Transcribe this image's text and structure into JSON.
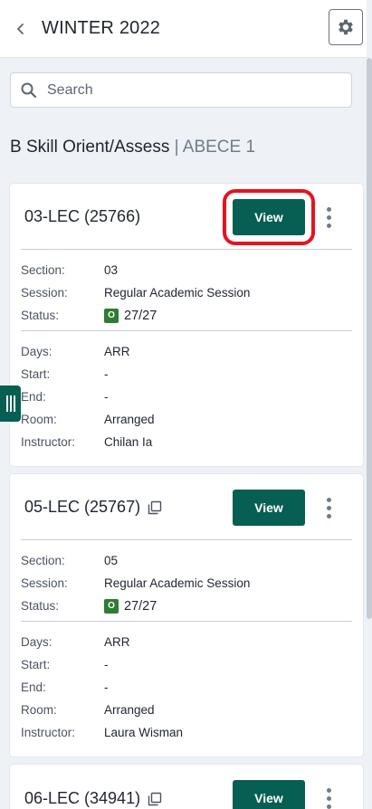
{
  "header": {
    "title": "WINTER 2022"
  },
  "search": {
    "placeholder": "Search"
  },
  "course": {
    "name": "B Skill Orient/Assess",
    "separator": " | ",
    "code": "ABECE 1"
  },
  "labels": {
    "section": "Section:",
    "session": "Session:",
    "status": "Status:",
    "days": "Days:",
    "start": "Start:",
    "end": "End:",
    "room": "Room:",
    "instructor": "Instructor:"
  },
  "view_label": "View",
  "cards": [
    {
      "title": "03-LEC (25766)",
      "section": "03",
      "session": "Regular Academic Session",
      "status_badge": "O",
      "status": "27/27",
      "days": "ARR",
      "start": "-",
      "end": "-",
      "room": "Arranged",
      "instructor": "Chilan Ia"
    },
    {
      "title": "05-LEC (25767)",
      "section": "05",
      "session": "Regular Academic Session",
      "status_badge": "O",
      "status": "27/27",
      "days": "ARR",
      "start": "-",
      "end": "-",
      "room": "Arranged",
      "instructor": "Laura Wisman"
    },
    {
      "title": "06-LEC (34941)"
    }
  ],
  "colors": {
    "accent": "#075e52",
    "open_badge": "#2e7d32",
    "highlight": "#e8121f"
  }
}
